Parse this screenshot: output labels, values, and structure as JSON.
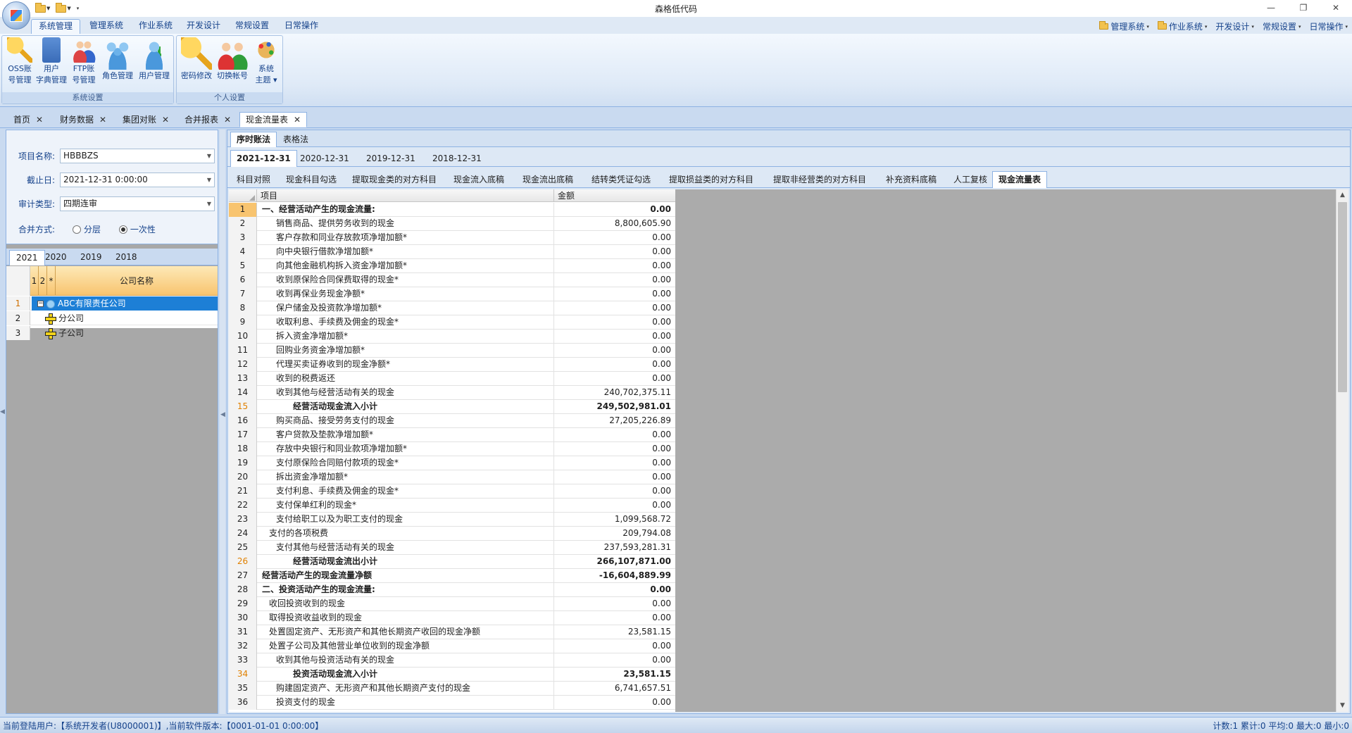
{
  "window": {
    "title": "森格低代码",
    "controls": [
      "—",
      "❐",
      "✕"
    ]
  },
  "ribbon": {
    "tabs": [
      "系统管理",
      "管理系统",
      "作业系统",
      "开发设计",
      "常规设置",
      "日常操作"
    ],
    "active_tab": "系统管理",
    "right_menus": [
      "管理系统",
      "作业系统",
      "开发设计",
      "常规设置",
      "日常操作"
    ],
    "groups": [
      {
        "label": "系统设置",
        "buttons": [
          {
            "line1": "OSS账",
            "line2": "号管理",
            "icon": "key-icon"
          },
          {
            "line1": "用户",
            "line2": "字典管理",
            "icon": "book-icon"
          },
          {
            "line1": "FTP账",
            "line2": "号管理",
            "icon": "people-icon"
          },
          {
            "line1": "",
            "line2": "角色管理",
            "icon": "roles-icon"
          },
          {
            "line1": "",
            "line2": "用户管理",
            "icon": "add-user-icon"
          }
        ]
      },
      {
        "label": "个人设置",
        "buttons": [
          {
            "line1": "",
            "line2": "密码修改",
            "icon": "key-icon"
          },
          {
            "line1": "",
            "line2": "切换帐号",
            "icon": "switch-user-icon"
          },
          {
            "line1": "系统",
            "line2": "主题 ▾",
            "icon": "palette-icon"
          }
        ]
      }
    ]
  },
  "doc_tabs": [
    "首页",
    "财务数据",
    "集团对账",
    "合并报表",
    "现金流量表"
  ],
  "active_doc_tab": "现金流量表",
  "params": {
    "project_label": "项目名称:",
    "project_value": "HBBBZS",
    "date_label": "截止日:",
    "date_value": "2021-12-31 0:00:00",
    "audit_label": "审计类型:",
    "audit_value": "四期连审",
    "merge_label": "合并方式:",
    "merge_options": [
      "分层",
      "一次性"
    ],
    "merge_selected": "一次性"
  },
  "year_tabs": [
    "2021",
    "2020",
    "2019",
    "2018"
  ],
  "active_year": "2021",
  "company_tree": {
    "headers": [
      "1",
      "2",
      "*",
      "公司名称"
    ],
    "rows": [
      {
        "no": "1",
        "name": "ABC有限责任公司",
        "selected": true,
        "icon": "org-icon"
      },
      {
        "no": "2",
        "name": "分公司",
        "selected": false,
        "icon": "branch-icon"
      },
      {
        "no": "3",
        "name": "子公司",
        "selected": false,
        "icon": "branch-icon"
      }
    ]
  },
  "method_tabs": [
    "序时账法",
    "表格法"
  ],
  "active_method": "序时账法",
  "date_tabs": [
    "2021-12-31",
    "2020-12-31",
    "2019-12-31",
    "2018-12-31"
  ],
  "active_date": "2021-12-31",
  "step_tabs": [
    "科目对照",
    "现金科目勾选",
    "提取现金类的对方科目",
    "现金流入底稿",
    "现金流出底稿",
    "结转类凭证勾选",
    "提取损益类的对方科目",
    "提取非经营类的对方科目",
    "补充资料底稿",
    "人工复核",
    "现金流量表"
  ],
  "active_step": "现金流量表",
  "grid": {
    "columns": [
      "项目",
      "金额"
    ],
    "rows": [
      {
        "no": "1",
        "item": "一、经营活动产生的现金流量:",
        "amount": "0.00",
        "bold": true,
        "indent": 1
      },
      {
        "no": "2",
        "item": "销售商品、提供劳务收到的现金",
        "amount": "8,800,605.90",
        "bold": false,
        "indent": 3
      },
      {
        "no": "3",
        "item": "客户存款和同业存放款项净增加额*",
        "amount": "0.00",
        "bold": false,
        "indent": 3
      },
      {
        "no": "4",
        "item": "向中央银行借款净增加额*",
        "amount": "0.00",
        "bold": false,
        "indent": 3
      },
      {
        "no": "5",
        "item": "向其他金融机构拆入资金净增加额*",
        "amount": "0.00",
        "bold": false,
        "indent": 3
      },
      {
        "no": "6",
        "item": "收到原保险合同保费取得的现金*",
        "amount": "0.00",
        "bold": false,
        "indent": 3
      },
      {
        "no": "7",
        "item": "收到再保业务现金净额*",
        "amount": "0.00",
        "bold": false,
        "indent": 3
      },
      {
        "no": "8",
        "item": "保户储金及投资款净增加额*",
        "amount": "0.00",
        "bold": false,
        "indent": 3
      },
      {
        "no": "9",
        "item": "收取利息、手续费及佣金的现金*",
        "amount": "0.00",
        "bold": false,
        "indent": 3
      },
      {
        "no": "10",
        "item": "拆入资金净增加额*",
        "amount": "0.00",
        "bold": false,
        "indent": 3
      },
      {
        "no": "11",
        "item": "回购业务资金净增加额*",
        "amount": "0.00",
        "bold": false,
        "indent": 3
      },
      {
        "no": "12",
        "item": "代理买卖证券收到的现金净额*",
        "amount": "0.00",
        "bold": false,
        "indent": 3
      },
      {
        "no": "13",
        "item": "收到的税费返还",
        "amount": "0.00",
        "bold": false,
        "indent": 3
      },
      {
        "no": "14",
        "item": "收到其他与经营活动有关的现金",
        "amount": "240,702,375.11",
        "bold": false,
        "indent": 3
      },
      {
        "no": "15",
        "item": "经营活动现金流入小计",
        "amount": "249,502,981.01",
        "bold": true,
        "indent": 4
      },
      {
        "no": "16",
        "item": "购买商品、接受劳务支付的现金",
        "amount": "27,205,226.89",
        "bold": false,
        "indent": 3
      },
      {
        "no": "17",
        "item": "客户贷款及垫款净增加额*",
        "amount": "0.00",
        "bold": false,
        "indent": 3
      },
      {
        "no": "18",
        "item": "存放中央银行和同业款项净增加额*",
        "amount": "0.00",
        "bold": false,
        "indent": 3
      },
      {
        "no": "19",
        "item": "支付原保险合同赔付款项的现金*",
        "amount": "0.00",
        "bold": false,
        "indent": 3
      },
      {
        "no": "20",
        "item": "拆出资金净增加额*",
        "amount": "0.00",
        "bold": false,
        "indent": 3
      },
      {
        "no": "21",
        "item": "支付利息、手续费及佣金的现金*",
        "amount": "0.00",
        "bold": false,
        "indent": 3
      },
      {
        "no": "22",
        "item": "支付保单红利的现金*",
        "amount": "0.00",
        "bold": false,
        "indent": 3
      },
      {
        "no": "23",
        "item": "支付给职工以及为职工支付的现金",
        "amount": "1,099,568.72",
        "bold": false,
        "indent": 3
      },
      {
        "no": "24",
        "item": "支付的各项税费",
        "amount": "209,794.08",
        "bold": false,
        "indent": 2
      },
      {
        "no": "25",
        "item": "支付其他与经营活动有关的现金",
        "amount": "237,593,281.31",
        "bold": false,
        "indent": 3
      },
      {
        "no": "26",
        "item": "经营活动现金流出小计",
        "amount": "266,107,871.00",
        "bold": true,
        "indent": 4
      },
      {
        "no": "27",
        "item": "经营活动产生的现金流量净额",
        "amount": "-16,604,889.99",
        "bold": true,
        "indent": 1
      },
      {
        "no": "28",
        "item": "二、投资活动产生的现金流量:",
        "amount": "0.00",
        "bold": true,
        "indent": 1
      },
      {
        "no": "29",
        "item": "收回投资收到的现金",
        "amount": "0.00",
        "bold": false,
        "indent": 2
      },
      {
        "no": "30",
        "item": "取得投资收益收到的现金",
        "amount": "0.00",
        "bold": false,
        "indent": 2
      },
      {
        "no": "31",
        "item": "处置固定资产、无形资产和其他长期资产收回的现金净额",
        "amount": "23,581.15",
        "bold": false,
        "indent": 2
      },
      {
        "no": "32",
        "item": "处置子公司及其他营业单位收到的现金净额",
        "amount": "0.00",
        "bold": false,
        "indent": 2
      },
      {
        "no": "33",
        "item": "收到其他与投资活动有关的现金",
        "amount": "0.00",
        "bold": false,
        "indent": 3
      },
      {
        "no": "34",
        "item": "投资活动现金流入小计",
        "amount": "23,581.15",
        "bold": true,
        "indent": 4
      },
      {
        "no": "35",
        "item": "购建固定资产、无形资产和其他长期资产支付的现金",
        "amount": "6,741,657.51",
        "bold": false,
        "indent": 3
      },
      {
        "no": "36",
        "item": "投资支付的现金",
        "amount": "0.00",
        "bold": false,
        "indent": 3
      }
    ]
  },
  "status": {
    "left": "当前登陆用户:【系统开发者(U8000001)】,当前软件版本:【0001-01-01 0:00:00】",
    "right": "计数:1 累计:0 平均:0 最大:0 最小:0"
  },
  "colors": {
    "ribbon_text": "#15428b",
    "selection": "#1d7fd6",
    "header_orange": "#f8c46f",
    "subtotal_rownum": "#e08000"
  }
}
